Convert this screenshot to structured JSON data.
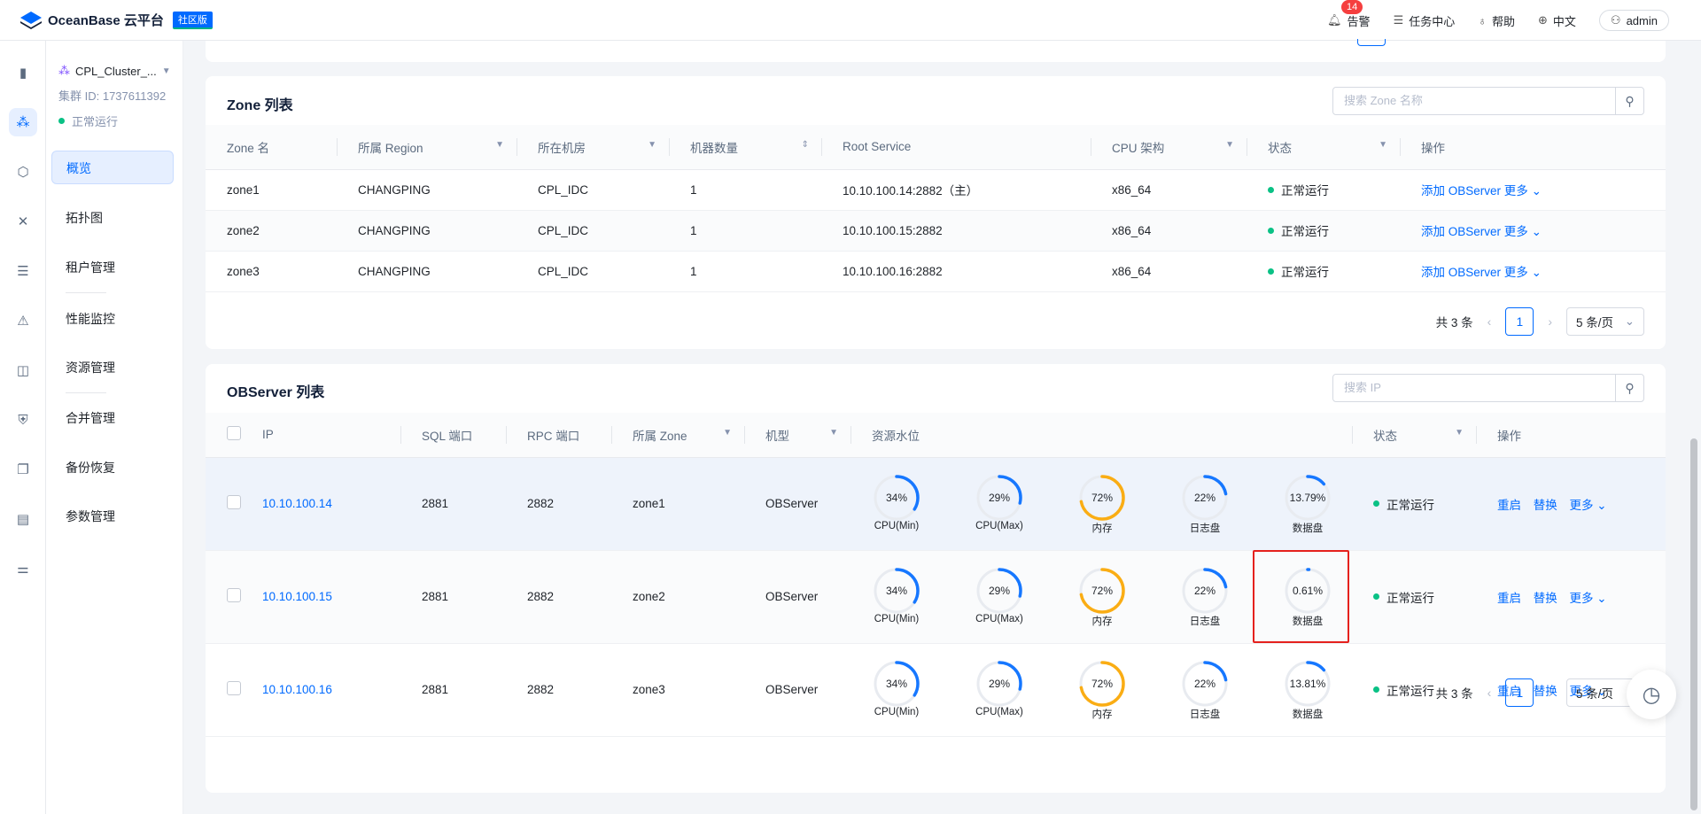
{
  "app": {
    "name": "OceanBase 云平台",
    "edition": "社区版"
  },
  "topbar": {
    "alarm": {
      "label": "告警",
      "count": "14"
    },
    "tasks": "任务中心",
    "help": "帮助",
    "lang": "中文",
    "user": "admin"
  },
  "cluster": {
    "name": "CPL_Cluster_...",
    "id": "集群 ID: 1737611392",
    "status": "正常运行"
  },
  "nav": [
    "概览",
    "拓扑图",
    "租户管理",
    "性能监控",
    "资源管理",
    "合并管理",
    "备份恢复",
    "参数管理"
  ],
  "zone_list": {
    "title": "Zone 列表",
    "search_placeholder": "搜索 Zone 名称",
    "columns": [
      "Zone 名",
      "所属 Region",
      "所在机房",
      "机器数量",
      "Root Service",
      "CPU 架构",
      "状态",
      "操作"
    ],
    "rows": [
      {
        "zone": "zone1",
        "region": "CHANGPING",
        "idc": "CPL_IDC",
        "count": "1",
        "rs": "10.10.100.14:2882（主）",
        "arch": "x86_64",
        "status": "正常运行",
        "op_add": "添加 OBServer",
        "op_more": "更多"
      },
      {
        "zone": "zone2",
        "region": "CHANGPING",
        "idc": "CPL_IDC",
        "count": "1",
        "rs": "10.10.100.15:2882",
        "arch": "x86_64",
        "status": "正常运行",
        "op_add": "添加 OBServer",
        "op_more": "更多"
      },
      {
        "zone": "zone3",
        "region": "CHANGPING",
        "idc": "CPL_IDC",
        "count": "1",
        "rs": "10.10.100.16:2882",
        "arch": "x86_64",
        "status": "正常运行",
        "op_add": "添加 OBServer",
        "op_more": "更多"
      }
    ],
    "pager": {
      "total": "共 3 条",
      "page": "1",
      "size": "5 条/页"
    }
  },
  "observer_list": {
    "title": "OBServer 列表",
    "search_placeholder": "搜索 IP",
    "columns": [
      "IP",
      "SQL 端口",
      "RPC 端口",
      "所属 Zone",
      "机型",
      "资源水位",
      "状态",
      "操作"
    ],
    "gauge_labels": [
      "CPU(Min)",
      "CPU(Max)",
      "内存",
      "日志盘",
      "数据盘"
    ],
    "rows": [
      {
        "ip": "10.10.100.14",
        "sql": "2881",
        "rpc": "2882",
        "zone": "zone1",
        "type": "OBServer",
        "gauges": [
          {
            "text": "34%",
            "v": 0.34,
            "color": "#1677ff"
          },
          {
            "text": "29%",
            "v": 0.29,
            "color": "#1677ff"
          },
          {
            "text": "72%",
            "v": 0.72,
            "color": "#faad14"
          },
          {
            "text": "22%",
            "v": 0.22,
            "color": "#1677ff"
          },
          {
            "text": "13.79%",
            "v": 0.1379,
            "color": "#1677ff"
          }
        ],
        "status": "正常运行",
        "op_restart": "重启",
        "op_replace": "替换",
        "op_more": "更多"
      },
      {
        "ip": "10.10.100.15",
        "sql": "2881",
        "rpc": "2882",
        "zone": "zone2",
        "type": "OBServer",
        "gauges": [
          {
            "text": "34%",
            "v": 0.34,
            "color": "#1677ff"
          },
          {
            "text": "29%",
            "v": 0.29,
            "color": "#1677ff"
          },
          {
            "text": "72%",
            "v": 0.72,
            "color": "#faad14"
          },
          {
            "text": "22%",
            "v": 0.22,
            "color": "#1677ff"
          },
          {
            "text": "0.61%",
            "v": 0.0061,
            "color": "#1677ff"
          }
        ],
        "status": "正常运行",
        "op_restart": "重启",
        "op_replace": "替换",
        "op_more": "更多"
      },
      {
        "ip": "10.10.100.16",
        "sql": "2881",
        "rpc": "2882",
        "zone": "zone3",
        "type": "OBServer",
        "gauges": [
          {
            "text": "34%",
            "v": 0.34,
            "color": "#1677ff"
          },
          {
            "text": "29%",
            "v": 0.29,
            "color": "#1677ff"
          },
          {
            "text": "72%",
            "v": 0.72,
            "color": "#faad14"
          },
          {
            "text": "22%",
            "v": 0.22,
            "color": "#1677ff"
          },
          {
            "text": "13.81%",
            "v": 0.1381,
            "color": "#1677ff"
          }
        ],
        "status": "正常运行",
        "op_restart": "重启",
        "op_replace": "替换",
        "op_more": "更多"
      }
    ],
    "pager": {
      "total": "共 3 条",
      "page": "1",
      "size": "5 条/页"
    }
  }
}
